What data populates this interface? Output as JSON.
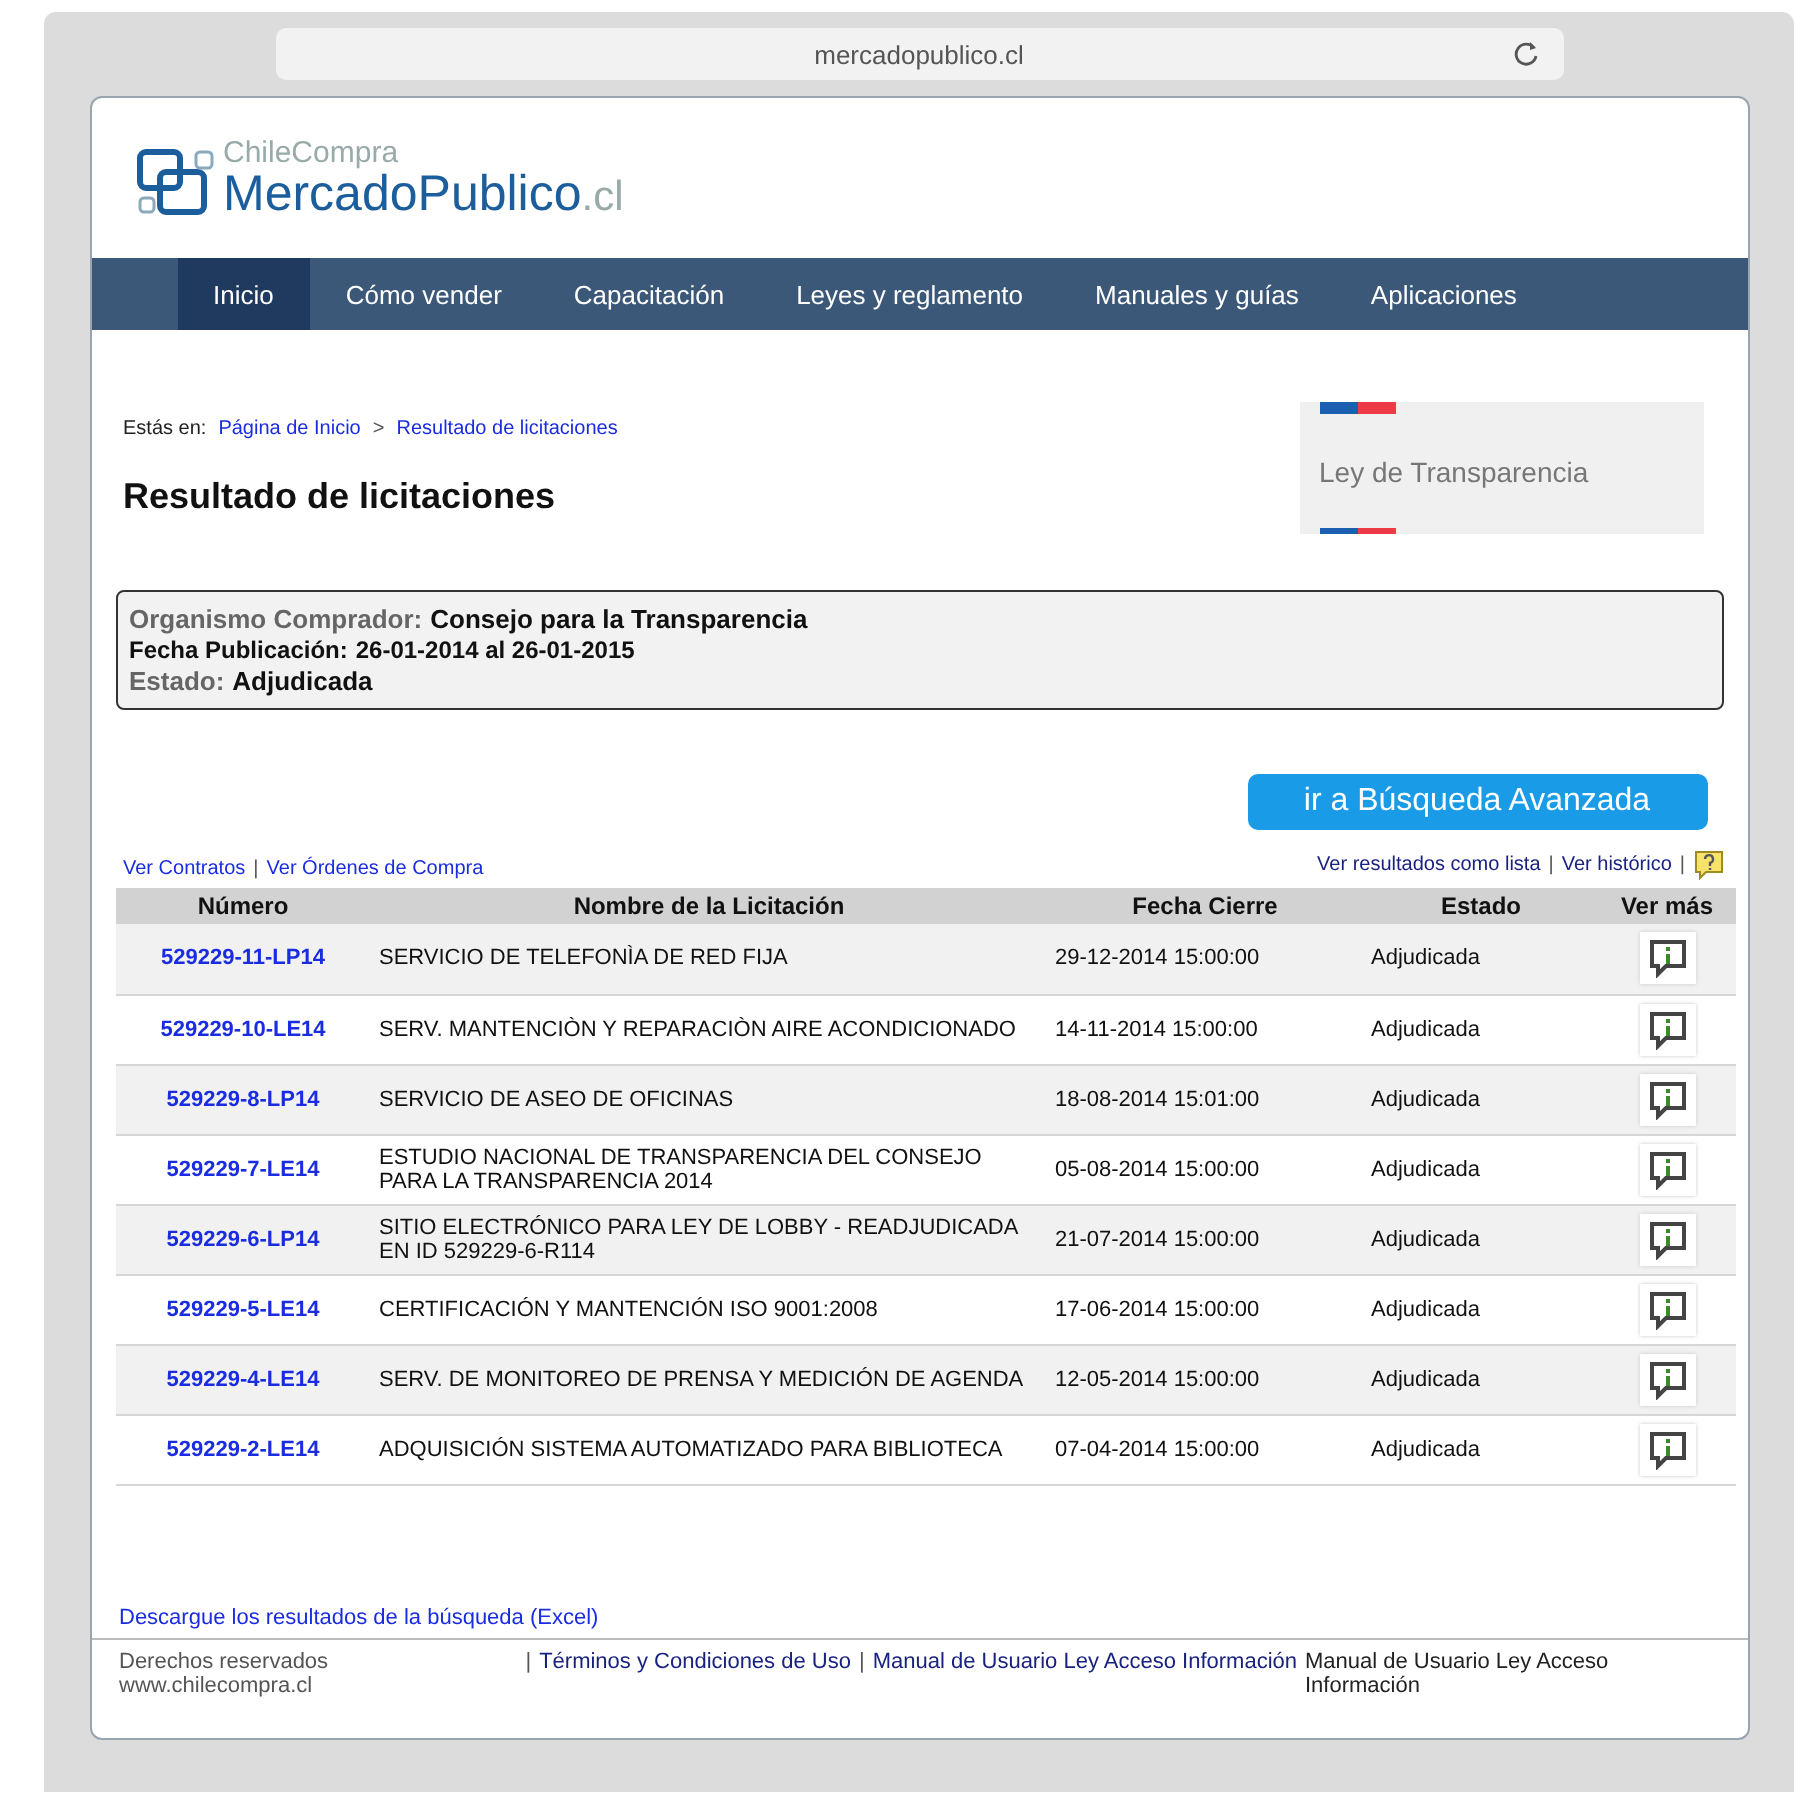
{
  "browser": {
    "address": "mercadopublico.cl"
  },
  "logo": {
    "top": "ChileCompra",
    "main": "MercadoPublico",
    "suffix": ".cl"
  },
  "nav": [
    {
      "label": "Inicio",
      "selected": true
    },
    {
      "label": "Cómo vender",
      "selected": false
    },
    {
      "label": "Capacitación",
      "selected": false
    },
    {
      "label": "Leyes y reglamento",
      "selected": false
    },
    {
      "label": "Manuales y guías",
      "selected": false
    },
    {
      "label": "Aplicaciones",
      "selected": false
    }
  ],
  "breadcrumb": {
    "prefix": "Estás en:",
    "items": [
      "Página de Inicio",
      "Resultado de licitaciones"
    ],
    "separator": ">"
  },
  "title": "Resultado de licitaciones",
  "transparency_banner": "Ley de Transparencia",
  "summary": [
    {
      "label": "Organismo Comprador:",
      "value": "Consejo para la Transparencia"
    },
    {
      "label": "Fecha Publicación:",
      "value": "26-01-2014 al 26-01-2015"
    },
    {
      "label": "Estado:",
      "value": "Adjudicada"
    }
  ],
  "advanced_search_button": "ir a Búsqueda Avanzada",
  "separator": "|",
  "links_left": [
    "Ver Contratos",
    "Ver Órdenes de Compra"
  ],
  "links_right": [
    "Ver resultados como lista",
    "Ver histórico"
  ],
  "table": {
    "columns": [
      "Número",
      "Nombre de la Licitación",
      "Fecha Cierre",
      "Estado",
      "Ver más"
    ],
    "rows": [
      {
        "number": "529229-11-LP14",
        "name": "SERVICIO DE TELEFONÌA DE RED FIJA",
        "closing": "29-12-2014 15:00:00",
        "status": "Adjudicada"
      },
      {
        "number": "529229-10-LE14",
        "name": "SERV. MANTENCIÒN Y REPARACIÒN AIRE ACONDICIONADO",
        "closing": "14-11-2014 15:00:00",
        "status": "Adjudicada"
      },
      {
        "number": "529229-8-LP14",
        "name": "SERVICIO DE ASEO DE OFICINAS",
        "closing": "18-08-2014 15:01:00",
        "status": "Adjudicada"
      },
      {
        "number": "529229-7-LE14",
        "name": "ESTUDIO NACIONAL DE TRANSPARENCIA DEL CONSEJO PARA LA TRANSPARENCIA 2014",
        "closing": "05-08-2014 15:00:00",
        "status": "Adjudicada"
      },
      {
        "number": "529229-6-LP14",
        "name": "SITIO ELECTRÓNICO PARA LEY DE LOBBY - READJUDICADA EN ID 529229-6-R114",
        "closing": "21-07-2014 15:00:00",
        "status": "Adjudicada"
      },
      {
        "number": "529229-5-LE14",
        "name": "CERTIFICACIÓN Y MANTENCIÓN ISO 9001:2008",
        "closing": "17-06-2014 15:00:00",
        "status": "Adjudicada"
      },
      {
        "number": "529229-4-LE14",
        "name": "SERV. DE MONITOREO DE PRENSA Y MEDICIÓN DE AGENDA",
        "closing": "12-05-2014 15:00:00",
        "status": "Adjudicada"
      },
      {
        "number": "529229-2-LE14",
        "name": "ADQUISICIÓN SISTEMA AUTOMATIZADO PARA BIBLIOTECA",
        "closing": "07-04-2014 15:00:00",
        "status": "Adjudicada"
      }
    ]
  },
  "download_link": "Descargue los resultados de la búsqueda (Excel)",
  "footer": {
    "copyright": "Derechos reservados www.chilecompra.cl",
    "links": [
      "Términos y Condiciones de Uso",
      "Manual de Usuario Ley Acceso Información"
    ],
    "trailing": "Manual de Usuario Ley Acceso Información"
  }
}
